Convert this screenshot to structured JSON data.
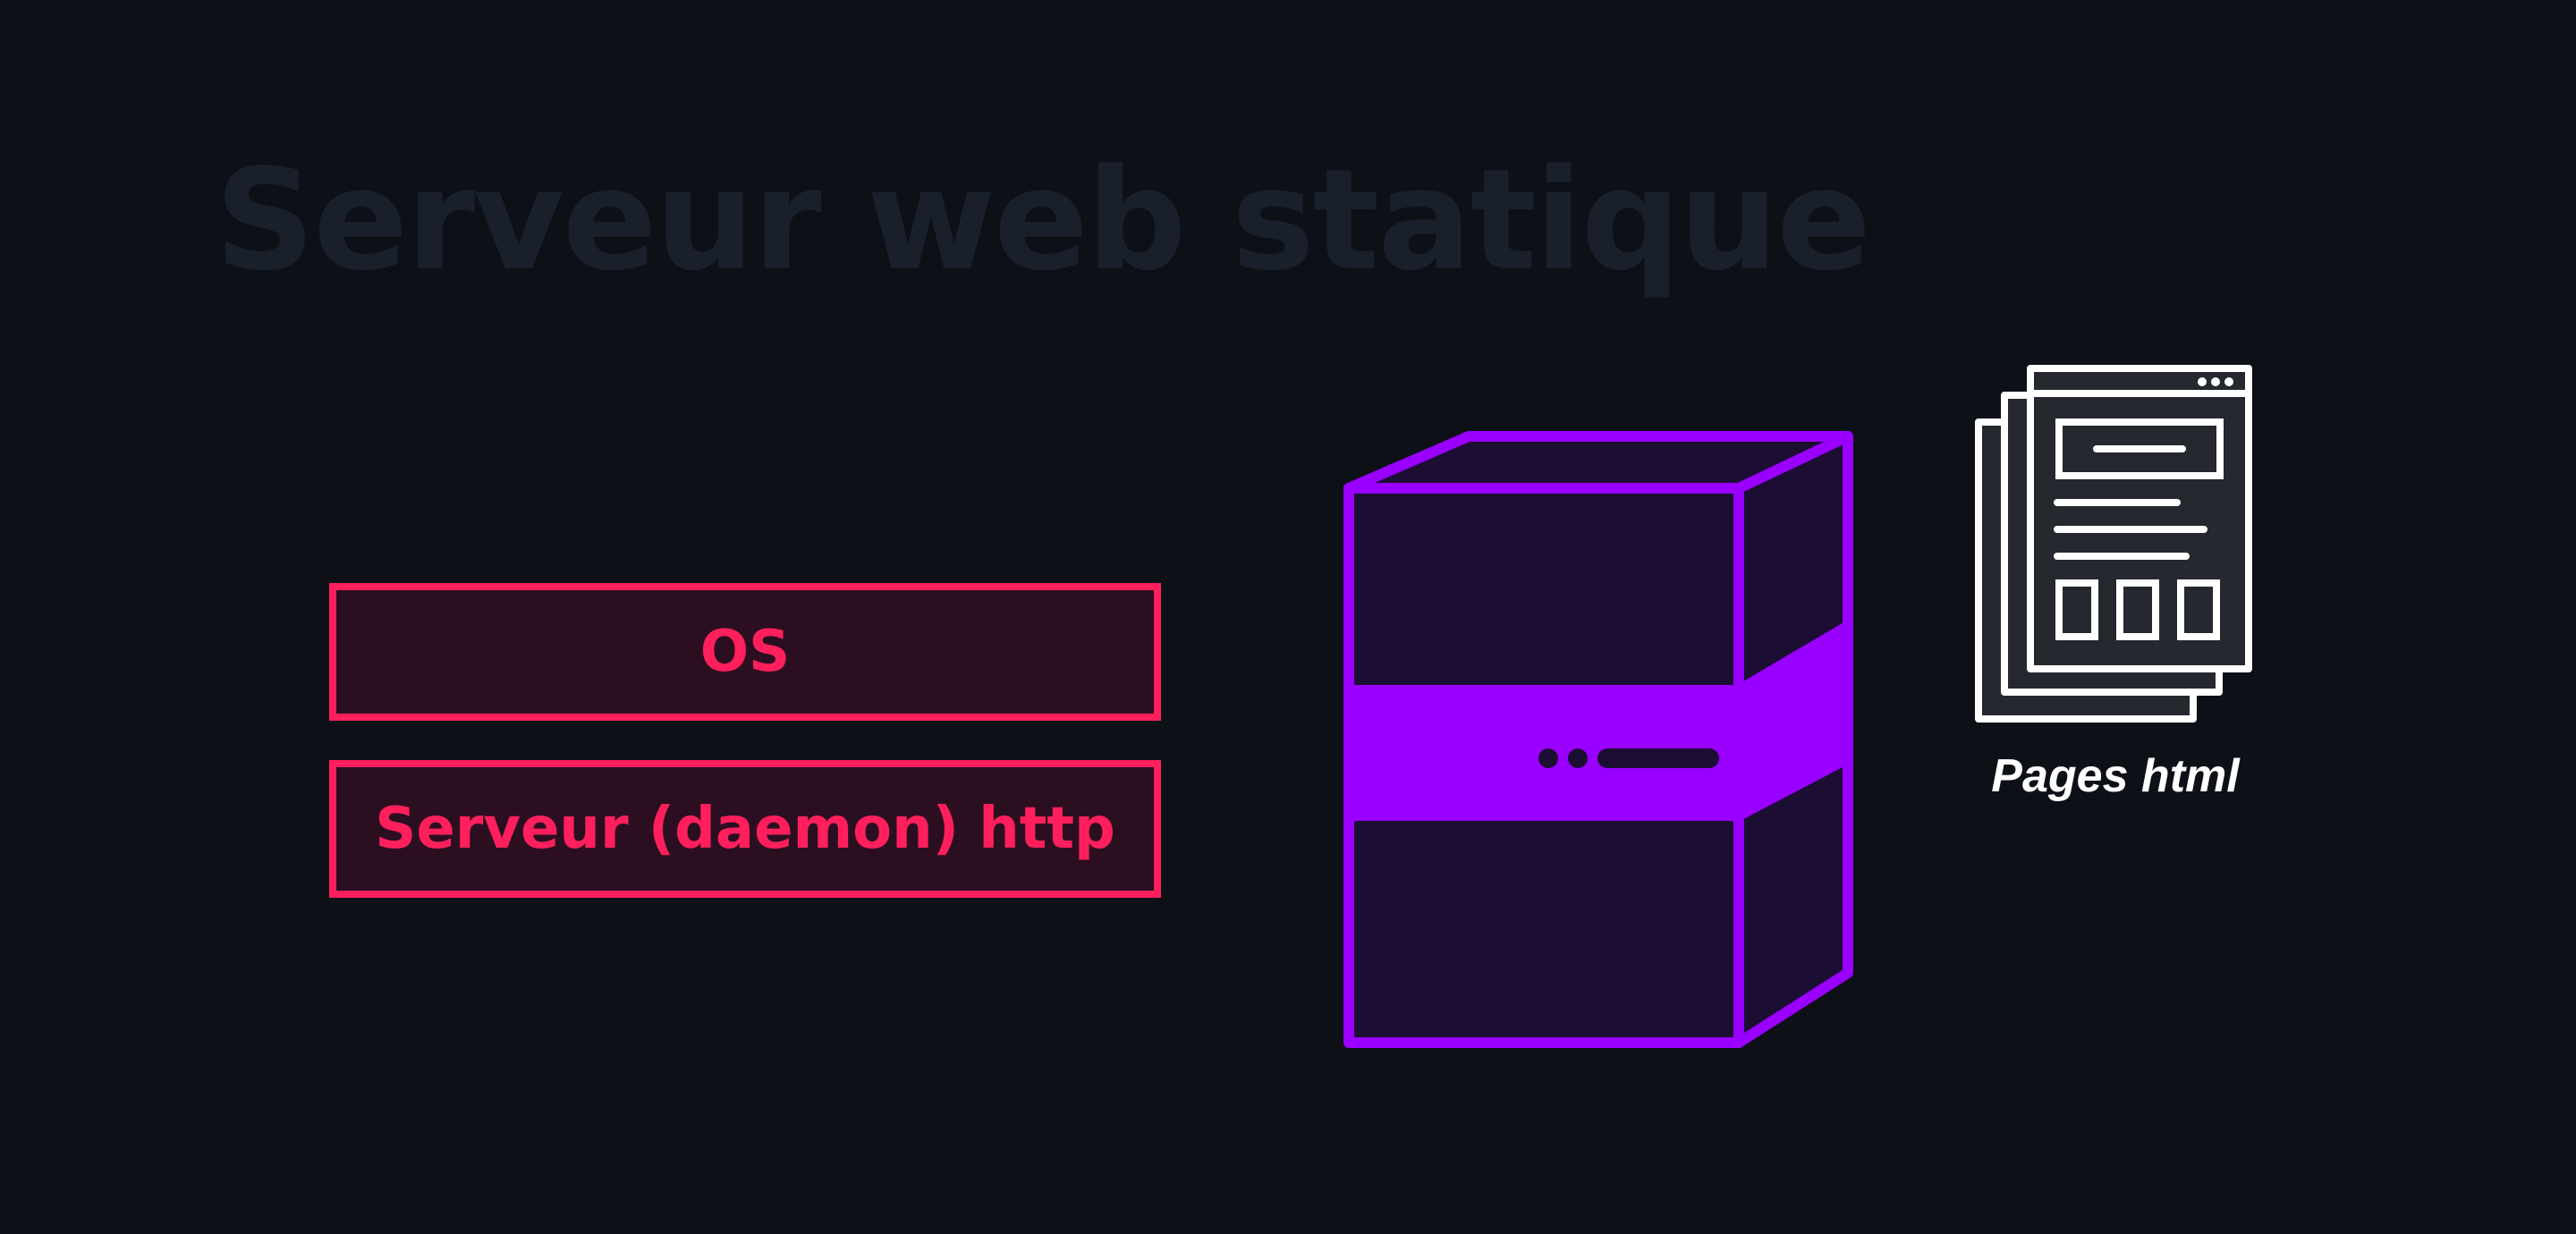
{
  "title": "Serveur web statique",
  "stack": {
    "os_label": "OS",
    "daemon_label": "Serveur (daemon) http"
  },
  "server": {
    "icon": "server-icon"
  },
  "pages": {
    "icon": "web-pages-icon",
    "label": "Pages html"
  },
  "colors": {
    "background": "#0d1017",
    "title": "#1a202b",
    "stack_accent": "#ff1f5c",
    "stack_fill": "#2b0f20",
    "server_accent": "#9900ff",
    "server_fill": "#1c0d33",
    "pages_stroke": "#ffffff",
    "pages_fill": "#25282e"
  }
}
